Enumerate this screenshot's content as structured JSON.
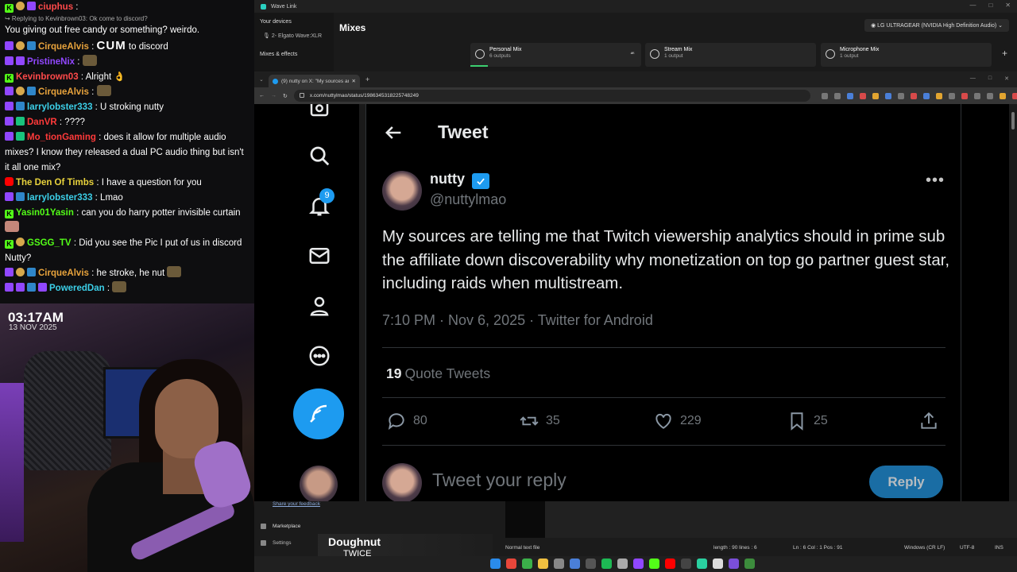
{
  "chat": {
    "messages": [
      {
        "user": "ciuphus",
        "color": "#ff4a4a",
        "text": ":",
        "badges": [
          "kick",
          "gold",
          "purple"
        ]
      },
      {
        "reply": "↪ Replying to Kevinbrown03: Ok come to discord?",
        "text": "You giving out free candy or something? weirdo."
      },
      {
        "user": "CirqueAlvis",
        "color": "#e8a33c",
        "text": ":",
        "big": "CUM",
        "tail": "to discord",
        "badges": [
          "purple",
          "gold",
          "blue"
        ]
      },
      {
        "user": "PristineNix",
        "color": "#9147ff",
        "text": ":",
        "badges": [
          "purple",
          "purple"
        ],
        "emote": true
      },
      {
        "user": "Kevinbrown03",
        "color": "#ff4a4a",
        "text": ": Alright 👌",
        "badges": [
          "kick"
        ]
      },
      {
        "user": "CirqueAlvis",
        "color": "#e8a33c",
        "text": ":",
        "badges": [
          "purple",
          "gold",
          "blue"
        ],
        "emote": true
      },
      {
        "user": "larrylobster333",
        "color": "#3ccfe8",
        "text": ": U stroking nutty",
        "badges": [
          "purple",
          "blue"
        ]
      },
      {
        "user": "DanVR",
        "color": "#ff3a3a",
        "text": ": ????",
        "badges": [
          "purple",
          "green"
        ]
      },
      {
        "user": "Mo_tionGaming",
        "color": "#ff3a3a",
        "text": ": does it allow for multiple audio mixes? I know they released a dual PC audio thing but isn't it all one mix?",
        "badges": [
          "purple",
          "green"
        ]
      },
      {
        "user": "The Den Of Timbs",
        "color": "#e8d23c",
        "text": ": I have a question for you",
        "badges": [
          "yt"
        ]
      },
      {
        "user": "larrylobster333",
        "color": "#3ccfe8",
        "text": ": Lmao",
        "badges": [
          "purple",
          "blue"
        ]
      },
      {
        "user": "Yasin01Yasin",
        "color": "#53fc18",
        "text": ": can you do harry potter invisible curtain",
        "badges": [
          "kick"
        ]
      },
      {
        "emote_only": true
      },
      {
        "user": "GSGG_TV",
        "color": "#53fc18",
        "text": ": Did you see the Pic I put of us in discord Nutty?",
        "badges": [
          "kick",
          "gold"
        ]
      },
      {
        "user": "CirqueAlvis",
        "color": "#e8a33c",
        "text": ": he stroke, he nut",
        "badges": [
          "purple",
          "gold",
          "blue"
        ],
        "emote": true
      },
      {
        "user": "PoweredDan",
        "color": "#3ccfe8",
        "text": ":",
        "badges": [
          "purple",
          "purple",
          "blue",
          "purple"
        ],
        "emote": true
      }
    ]
  },
  "cam": {
    "time": "03:17AM",
    "date": "13 NOV 2025"
  },
  "wavelink": {
    "title": "Wave Link",
    "sidebar_devices": "Your devices",
    "device_item": "2- Elgato Wave:XLR",
    "sidebar_mixes": "Mixes & effects",
    "page_title": "Mixes",
    "output_device": "LG ULTRAGEAR (NVIDIA High Definition Audio)",
    "mixes": [
      {
        "name": "Personal Mix",
        "sub": "6 outputs"
      },
      {
        "name": "Stream Mix",
        "sub": "1 output"
      },
      {
        "name": "Microphone Mix",
        "sub": "1 output"
      }
    ],
    "add": "+"
  },
  "browser": {
    "tab_title": "(9) nutty on X: \"My sources are telling me...\"",
    "url": "x.com/nuttylmao/status/1986345318225748249"
  },
  "tweet": {
    "header": "Tweet",
    "author_name": "nutty",
    "author_handle": "@nuttylmao",
    "text": "My sources are telling me that Twitch viewership analytics should in prime sub the affiliate down discoverability why monetization on top go partner guest star, including raids when multistream.",
    "meta": "7:10 PM · Nov 6, 2025 · Twitter for Android",
    "quote_count": "19",
    "quote_label": "Quote Tweets",
    "replies": "80",
    "retweets": "35",
    "likes": "229",
    "bookmarks": "25",
    "reply_placeholder": "Tweet your reply",
    "reply_button": "Reply",
    "notifications": "9",
    "more": "•••"
  },
  "bottom": {
    "feedback": "Share your feedback",
    "marketplace": "Marketplace",
    "settings": "Settings",
    "status_type": "Normal text file",
    "status_length": "length : 90    lines : 6",
    "status_pos": "Ln : 6    Col : 1    Pos : 91",
    "status_eol": "Windows (CR LF)",
    "status_enc": "UTF-8",
    "status_ins": "INS"
  },
  "nowplaying": {
    "title": "Doughnut",
    "artist": "TWICE"
  }
}
